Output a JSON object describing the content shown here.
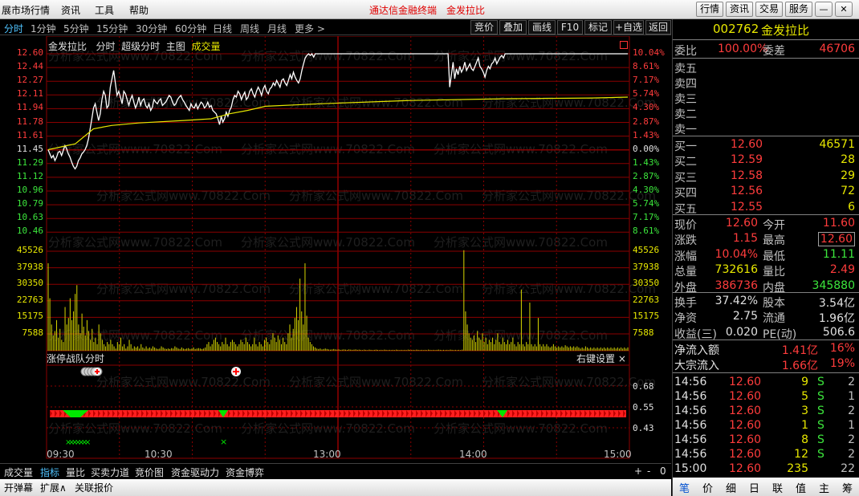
{
  "titlebar": {
    "menu": [
      "展市场行情",
      "资讯",
      "工具",
      "帮助"
    ],
    "center": [
      "通达信金融终端",
      "金发拉比"
    ],
    "buttons": [
      "行情",
      "资讯",
      "交易",
      "服务"
    ],
    "win": [
      "—",
      "✕"
    ]
  },
  "periods": [
    "分时",
    "1分钟",
    "5分钟",
    "15分钟",
    "30分钟",
    "60分钟",
    "日线",
    "周线",
    "月线",
    "更多 >"
  ],
  "tools": [
    "竞价",
    "叠加",
    "画线",
    "F10",
    "标记",
    "+自选",
    "返回"
  ],
  "chart": {
    "header": [
      "金发拉比",
      "分时",
      "超级分时",
      "主图"
    ],
    "header_volume": "成交量",
    "price_labels": [
      "12.60",
      "12.44",
      "12.27",
      "12.11",
      "11.94",
      "11.78",
      "11.61",
      "11.45",
      "11.29",
      "11.12",
      "10.96",
      "10.79",
      "10.63",
      "10.46"
    ],
    "pct_labels": [
      "10.04%",
      "8.61%",
      "7.17%",
      "5.74%",
      "4.30%",
      "2.87%",
      "1.43%",
      "0.00%",
      "1.43%",
      "2.87%",
      "4.30%",
      "5.74%",
      "7.17%",
      "8.61%"
    ],
    "vol_labels": [
      "45526",
      "37938",
      "30350",
      "22763",
      "15175",
      "7588"
    ],
    "indicator_title": "涨停战队分时",
    "indicator_setting": "右键设置",
    "indicator_close": "×",
    "indicator_labels": [
      "0.68",
      "0.55",
      "0.43"
    ],
    "time_labels": [
      "09:30",
      "10:30",
      "13:00",
      "14:00",
      "15:00"
    ],
    "watermark": "分析家公式网www.70822.Com",
    "price_line": [
      11.45,
      11.4,
      11.35,
      11.38,
      11.32,
      11.36,
      11.42,
      11.43,
      11.38,
      11.44,
      11.5,
      11.46,
      11.4,
      11.36,
      11.3,
      11.25,
      11.22,
      11.25,
      11.32,
      11.35,
      11.4,
      11.42,
      11.45,
      11.5,
      11.58,
      11.7,
      11.82,
      11.95,
      12.0,
      11.9,
      11.8,
      11.88,
      12.05,
      12.15,
      12.1,
      11.95,
      11.98,
      12.2,
      12.3,
      12.4,
      12.25,
      12.1,
      12.15,
      12.08,
      12.0,
      12.15,
      12.12,
      12.05,
      11.98,
      12.05,
      12.1,
      12.02,
      11.95,
      12.0,
      12.08,
      11.98,
      12.04,
      12.06,
      11.98,
      11.95,
      12.0,
      11.92,
      11.96,
      12.05,
      12.02,
      12.0,
      12.04,
      12.06,
      11.98,
      12.0,
      12.02,
      12.06,
      12.1,
      12.08,
      12.02,
      11.98,
      12.0,
      12.05,
      12.08,
      12.1,
      12.05,
      12.02,
      11.98,
      11.95,
      11.92,
      12.0,
      11.96,
      11.95,
      12.0,
      11.94,
      11.98,
      12.02,
      12.0,
      11.95,
      11.97,
      12.02,
      11.96,
      11.98,
      11.92,
      11.9,
      11.88,
      11.82,
      11.75,
      11.85,
      11.78,
      11.82,
      11.9,
      11.85,
      11.92,
      11.96,
      12.05,
      12.1,
      12.08,
      12.15,
      12.12,
      12.05,
      12.1,
      12.14,
      12.05,
      12.08,
      12.15,
      12.18,
      12.12,
      12.08,
      12.15,
      12.2,
      12.16,
      12.1,
      12.18,
      12.22,
      12.15,
      12.12,
      12.18,
      12.2,
      12.25,
      12.22,
      12.28,
      12.24,
      12.2,
      12.28,
      12.3,
      12.25,
      12.22,
      12.28,
      12.35,
      12.3,
      12.38,
      12.32,
      12.28,
      12.25,
      12.3,
      12.4,
      12.48,
      12.55,
      12.58,
      12.6,
      12.58,
      12.6,
      12.56,
      12.6,
      12.6,
      12.6,
      12.6,
      12.6,
      12.6,
      12.6,
      12.6,
      12.6,
      12.6,
      12.6,
      12.6,
      12.6,
      12.6,
      12.6,
      12.6,
      12.6,
      12.6,
      12.6,
      12.6,
      12.6,
      12.6,
      12.6,
      12.6,
      12.6,
      12.6,
      12.6,
      12.6,
      12.6,
      12.6,
      12.6,
      12.6,
      12.6,
      12.6,
      12.6,
      12.6,
      12.6,
      12.6,
      12.6,
      12.6,
      12.6,
      12.6,
      12.6,
      12.6,
      12.6,
      12.6,
      12.6,
      12.6,
      12.6,
      12.6,
      12.6,
      12.6,
      12.6,
      12.6,
      12.6,
      12.6,
      12.6,
      12.6,
      12.6,
      12.6,
      12.6,
      12.6,
      12.6,
      12.6,
      12.6,
      12.6,
      12.6,
      12.6,
      12.6,
      12.6,
      12.6,
      12.6,
      12.6,
      12.6,
      12.6,
      12.6,
      12.6,
      12.6,
      12.6,
      12.6,
      12.2,
      12.35,
      12.5,
      12.3,
      12.42,
      12.35,
      12.45,
      12.38,
      12.42,
      12.5,
      12.4,
      12.44,
      12.48,
      12.42,
      12.4,
      12.45,
      12.5,
      12.55,
      12.45,
      12.42,
      12.38,
      12.32,
      12.4,
      12.45,
      12.42,
      12.48,
      12.5,
      12.55,
      12.48,
      12.52,
      12.56,
      12.58,
      12.55,
      12.6,
      12.6,
      12.6,
      12.6,
      12.6,
      12.6,
      12.6,
      12.6,
      12.6,
      12.6,
      12.6,
      12.6,
      12.6,
      12.6,
      12.6,
      12.6,
      12.6,
      12.6,
      12.6,
      12.6,
      12.6,
      12.6,
      12.6,
      12.6,
      12.6,
      12.6,
      12.6,
      12.6,
      12.6,
      12.6,
      12.6,
      12.6,
      12.6,
      12.6,
      12.6,
      12.6,
      12.6,
      12.6,
      12.6,
      12.6,
      12.6,
      12.6,
      12.6,
      12.6,
      12.6,
      12.6,
      12.6,
      12.6,
      12.6,
      12.6,
      12.6,
      12.6,
      12.6,
      12.6,
      12.6,
      12.6,
      12.6,
      12.6,
      12.6,
      12.6,
      12.6,
      12.6,
      12.6,
      12.6,
      12.6,
      12.6,
      12.6,
      12.6,
      12.6,
      12.6,
      12.6,
      12.6,
      12.6,
      12.6
    ],
    "avg_line_points": [
      [
        0,
        11.45
      ],
      [
        30,
        11.52
      ],
      [
        50,
        11.7
      ],
      [
        70,
        11.74
      ],
      [
        100,
        11.77
      ],
      [
        150,
        11.8
      ],
      [
        180,
        11.82
      ],
      [
        200,
        11.88
      ],
      [
        220,
        11.92
      ],
      [
        240,
        11.97
      ],
      [
        300,
        12.0
      ],
      [
        400,
        12.04
      ],
      [
        500,
        12.06
      ],
      [
        600,
        12.07
      ],
      [
        640,
        12.08
      ]
    ],
    "volumes": [
      40000,
      24000,
      12000,
      7000,
      9000,
      14000,
      6000,
      10000,
      5000,
      4000,
      20000,
      12000,
      15000,
      24000,
      14000,
      18000,
      26000,
      30000,
      12000,
      8000,
      17000,
      11000,
      7000,
      14000,
      9000,
      5000,
      10000,
      4000,
      6000,
      3000,
      12000,
      8000,
      5000,
      3000,
      2000,
      4000,
      3000,
      5000,
      3000,
      2000,
      1000,
      4000,
      3000,
      6000,
      2000,
      3000,
      1000,
      2000,
      5000,
      3000,
      1000,
      2000,
      1500,
      2000,
      1000,
      3000,
      1500,
      1000,
      2000,
      1000,
      1500,
      1000,
      2000,
      1500,
      1000,
      800,
      1000,
      2000,
      1500,
      1000,
      800,
      1000,
      800,
      1200,
      1000,
      2000,
      1500,
      1000,
      800,
      1500,
      1000,
      800,
      1000,
      1200,
      800,
      1000,
      1500,
      800,
      1000,
      1200,
      1000,
      800,
      1000,
      1500,
      3000,
      4000,
      2000,
      3000,
      5000,
      6000,
      4000,
      3000,
      2000,
      4000,
      3000,
      6000,
      3000,
      2000,
      4000,
      5000,
      4000,
      3000,
      2000,
      3000,
      5000,
      4000,
      3000,
      6000,
      4000,
      3000,
      2000,
      3000,
      6000,
      3000,
      2000,
      4000,
      3000,
      2000,
      5000,
      6000,
      4000,
      3000,
      5000,
      8000,
      6000,
      4000,
      7000,
      5000,
      3000,
      6000,
      4000,
      3000,
      8000,
      12000,
      6000,
      10000,
      15000,
      20000,
      14000,
      33000,
      18000,
      12000,
      40000,
      16000,
      6000,
      4000,
      3000,
      2000,
      1500,
      1000,
      800,
      1000,
      600,
      800,
      1000,
      800,
      600,
      500,
      600,
      800,
      600,
      500,
      600,
      400,
      500,
      600,
      500,
      400,
      600,
      500,
      400,
      500,
      600,
      400,
      500,
      400,
      300,
      500,
      400,
      300,
      500,
      400,
      300,
      400,
      500,
      400,
      300,
      400,
      300,
      500,
      400,
      300,
      400,
      300,
      400,
      300,
      500,
      400,
      300,
      400,
      300,
      400,
      300,
      500,
      400,
      300,
      400,
      300,
      500,
      400,
      300,
      400,
      300,
      400,
      300,
      500,
      400,
      300,
      400,
      300,
      400,
      500,
      400,
      300,
      400,
      300,
      400,
      300,
      500,
      400,
      300,
      400,
      300,
      400,
      300,
      500,
      46000,
      18000,
      12000,
      8000,
      6000,
      5000,
      7000,
      4000,
      9000,
      6000,
      5000,
      8000,
      4000,
      6000,
      3000,
      5000,
      4000,
      6000,
      3000,
      5000,
      8000,
      4000,
      3000,
      6000,
      4000,
      3000,
      5000,
      3000,
      4000,
      6000,
      3000,
      2000,
      4000,
      3000,
      2000,
      3000,
      2000,
      4000,
      3000,
      2000,
      3000,
      2000,
      3000,
      2000,
      4000,
      3000,
      2000,
      3000,
      2000,
      3000,
      2000,
      1500,
      2000,
      3000,
      2000,
      1500,
      2000,
      1500,
      2000,
      1500,
      2500,
      2000,
      1500,
      2000,
      1500,
      2000,
      1500,
      2000,
      1500,
      1000,
      1500,
      1000,
      2000,
      1500,
      1000,
      1500,
      1000,
      1500,
      1000,
      1500,
      1000,
      1500,
      1000,
      1500,
      1000,
      1500,
      1000,
      1500,
      1000,
      1500,
      1000,
      1500,
      1000,
      1500,
      1000,
      1500,
      1000,
      1500
    ],
    "extra_volume_spikes": [
      [
        280,
        28000
      ],
      [
        285,
        22000
      ],
      [
        290,
        15000
      ],
      [
        430,
        12000
      ],
      [
        440,
        8000
      ],
      [
        450,
        25000
      ],
      [
        460,
        30000
      ]
    ]
  },
  "right": {
    "code": "002762",
    "name": "金发拉比",
    "weibi_label": "委比",
    "weibi_val": "100.00%",
    "weicha_label": "委差",
    "weicha_val": "46706",
    "sells": [
      "卖五",
      "卖四",
      "卖三",
      "卖二",
      "卖一"
    ],
    "buys": [
      {
        "l": "买一",
        "p": "12.60",
        "v": "46571"
      },
      {
        "l": "买二",
        "p": "12.59",
        "v": "28"
      },
      {
        "l": "买三",
        "p": "12.58",
        "v": "29"
      },
      {
        "l": "买四",
        "p": "12.56",
        "v": "72"
      },
      {
        "l": "买五",
        "p": "12.55",
        "v": "6"
      }
    ],
    "stats": [
      {
        "a": "现价",
        "b": "12.60",
        "c": "今开",
        "d": "11.60"
      },
      {
        "a": "涨跌",
        "b": "1.15",
        "c": "最高",
        "d": "12.60"
      },
      {
        "a": "涨幅",
        "b": "10.04%",
        "c": "最低",
        "d": "11.11"
      },
      {
        "a": "总量",
        "b": "732616",
        "c": "量比",
        "d": "2.49"
      },
      {
        "a": "外盘",
        "b": "386736",
        "c": "内盘",
        "d": "345880"
      }
    ],
    "stats2": [
      {
        "a": "换手",
        "b": "37.42%",
        "c": "股本",
        "d": "3.54亿"
      },
      {
        "a": "净资",
        "b": "2.75",
        "c": "流通",
        "d": "1.96亿"
      },
      {
        "a": "收益(三)",
        "b": "0.020",
        "c": "PE(动)",
        "d": "506.6"
      }
    ],
    "flow": [
      {
        "a": "净流入额",
        "b": "1.41亿",
        "c": "16%"
      },
      {
        "a": "大宗流入",
        "b": "1.66亿",
        "c": "19%"
      }
    ],
    "ticks": [
      {
        "t": "14:56",
        "p": "12.60",
        "v": "9",
        "s": "S",
        "n": "2"
      },
      {
        "t": "14:56",
        "p": "12.60",
        "v": "5",
        "s": "S",
        "n": "1"
      },
      {
        "t": "14:56",
        "p": "12.60",
        "v": "3",
        "s": "S",
        "n": "2"
      },
      {
        "t": "14:56",
        "p": "12.60",
        "v": "1",
        "s": "S",
        "n": "1"
      },
      {
        "t": "14:56",
        "p": "12.60",
        "v": "8",
        "s": "S",
        "n": "2"
      },
      {
        "t": "14:56",
        "p": "12.60",
        "v": "12",
        "s": "S",
        "n": "2"
      },
      {
        "t": "15:00",
        "p": "12.60",
        "v": "235",
        "s": "",
        "n": "22"
      }
    ],
    "tabs": [
      "笔",
      "价",
      "细",
      "日",
      "联",
      "值",
      "主",
      "筹"
    ]
  },
  "bottom": {
    "tabs": [
      "成交量",
      "指标",
      "量比",
      "买卖力道",
      "竞价图",
      "资金驱动力",
      "资金博弈"
    ],
    "right": [
      "+",
      "-",
      "0"
    ],
    "tabs2": [
      "开弹幕",
      "扩展∧",
      "关联报价"
    ]
  },
  "colors": {
    "red": "#ff3232",
    "green": "#00e600",
    "yellow": "#e8e800",
    "white": "#ffffff",
    "grid": "#8b0000",
    "label_red": "#ff3c3c"
  }
}
